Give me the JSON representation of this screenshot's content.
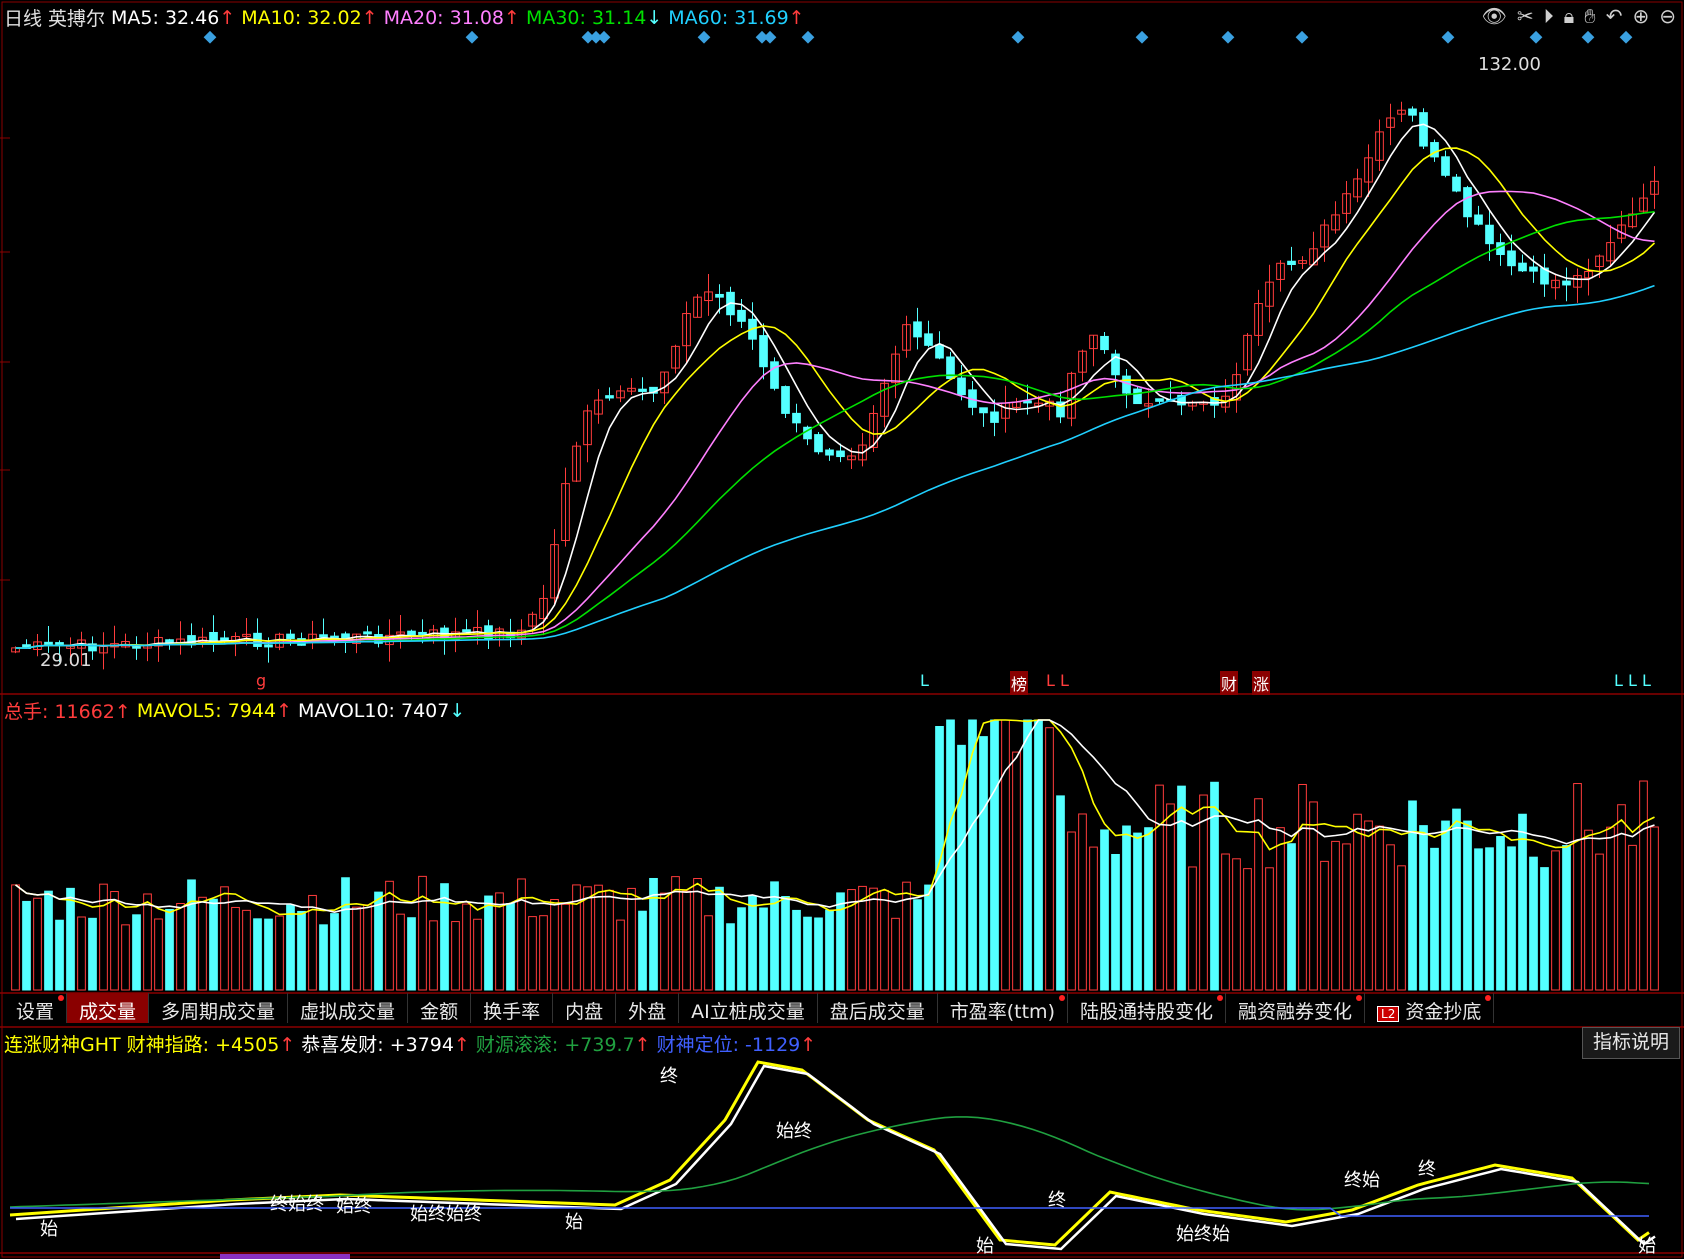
{
  "price_header": {
    "period": "日线",
    "stock_name": "英搏尔",
    "ma5": "MA5: 32.46",
    "ma10": "MA10: 32.02",
    "ma20": "MA20: 31.08",
    "ma30": "MA30: 31.14",
    "ma60": "MA60: 31.69",
    "ma5_arrow": "↑",
    "ma10_arrow": "↑",
    "ma20_arrow": "↑",
    "ma30_arrow": "↓",
    "ma60_arrow": "↑"
  },
  "price_labels": {
    "high": "132.00",
    "low": "29.01"
  },
  "bottom_markers": [
    "g",
    "L",
    "榜",
    "L L",
    "财",
    "涨",
    "L L L"
  ],
  "volume_header": {
    "total": "总手: 11662",
    "total_arrow": "↑",
    "mavol5": "MAVOL5: 7944",
    "mavol5_arrow": "↑",
    "mavol10": "MAVOL10: 7407",
    "mavol10_arrow": "↓"
  },
  "tabs": [
    {
      "label": "设置",
      "dot": true
    },
    {
      "label": "成交量",
      "active": true
    },
    {
      "label": "多周期成交量"
    },
    {
      "label": "虚拟成交量"
    },
    {
      "label": "金额"
    },
    {
      "label": "换手率"
    },
    {
      "label": "内盘"
    },
    {
      "label": "外盘"
    },
    {
      "label": "AI立桩成交量"
    },
    {
      "label": "盘后成交量"
    },
    {
      "label": "市盈率(ttm)",
      "dot": true
    },
    {
      "label": "陆股通持股变化",
      "dot": true
    },
    {
      "label": "融资融券变化",
      "dot": true
    },
    {
      "label": "资金抄底",
      "badge": "L2",
      "dot": true
    }
  ],
  "indicator_header": {
    "name": "连涨财神GHT",
    "road": "财神指路: +4505",
    "road_arrow": "↑",
    "congrats": "恭喜发财: +3794",
    "congrats_arrow": "↑",
    "source": "财源滚滚: +739.7",
    "source_arrow": "↑",
    "position": "财神定位: -1129",
    "position_arrow": "↑"
  },
  "explain_button": "指标说明",
  "indicator_labels": [
    "始",
    "终始终",
    "始终",
    "始终始终",
    "始",
    "终",
    "始终",
    "始",
    "终",
    "始终始",
    "终始",
    "终",
    "始"
  ],
  "toolbar_icons": [
    "eye-icon",
    "scissors-icon",
    "play-icon",
    "lock-icon",
    "hand-icon",
    "undo-icon",
    "zoom-in-icon",
    "zoom-out-icon"
  ],
  "colors": {
    "up": "#ff3c3c",
    "down": "#54ffff",
    "ma5": "#ffffff",
    "ma10": "#ffff00",
    "ma20": "#ff80ff",
    "ma30": "#00e000",
    "ma60": "#20d0ff",
    "grid": "#8a0000"
  }
}
